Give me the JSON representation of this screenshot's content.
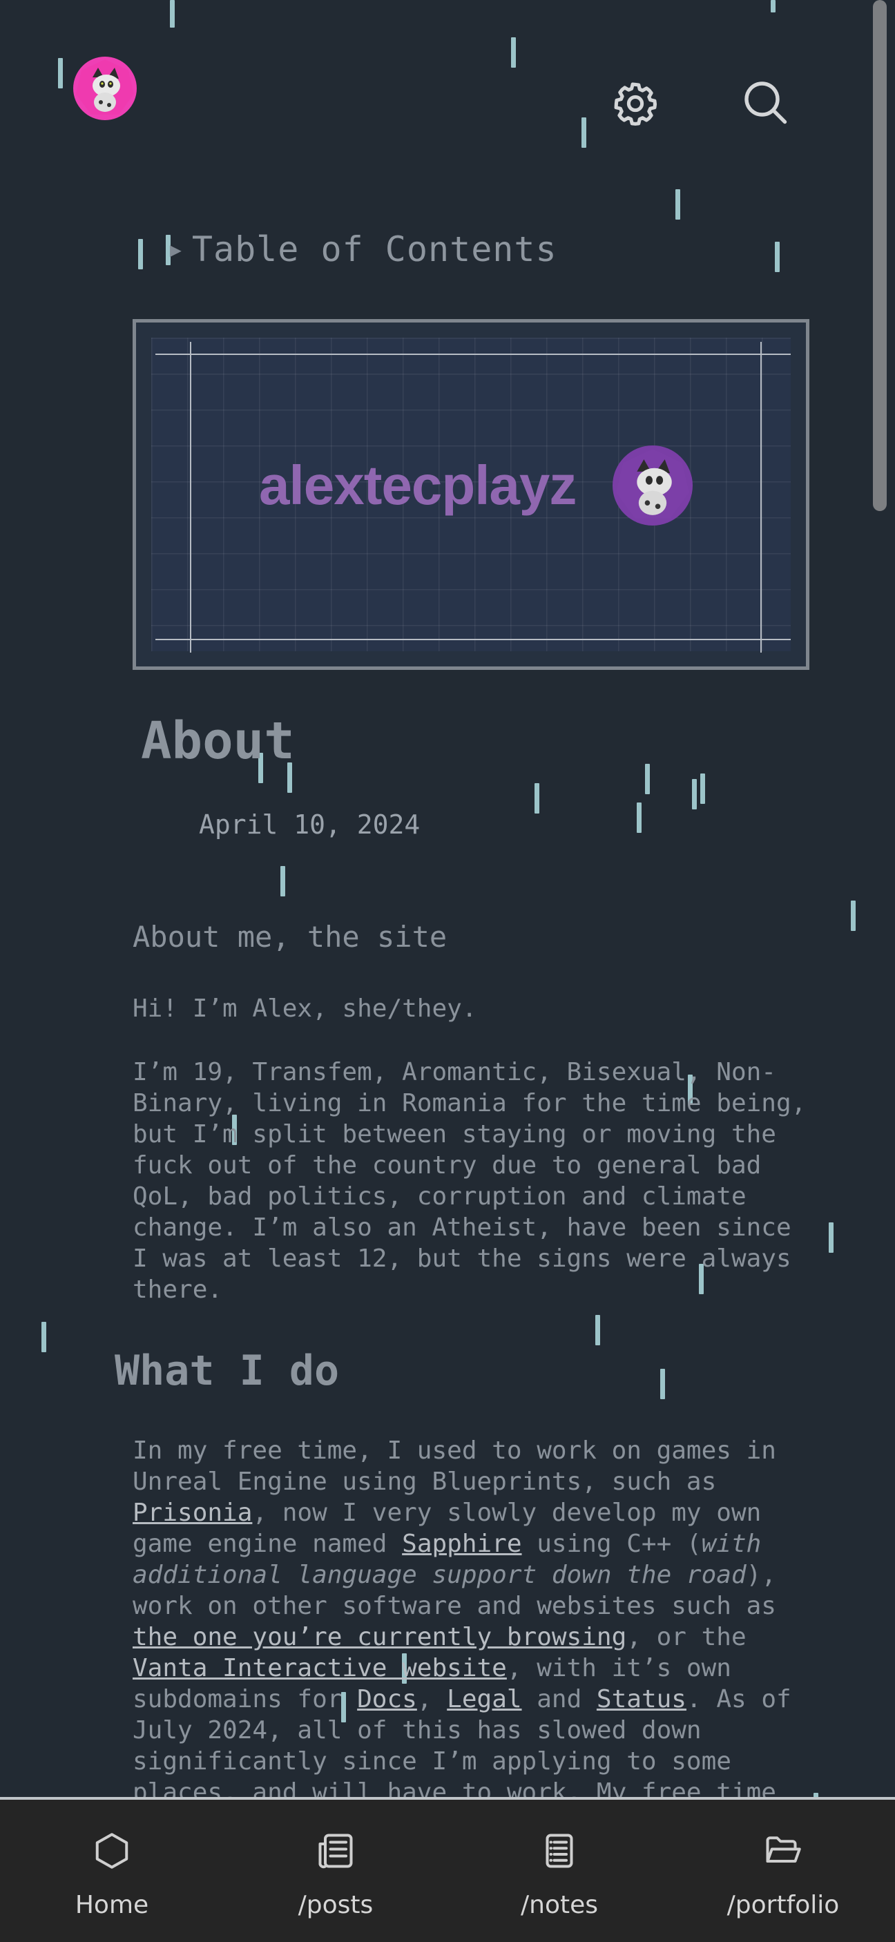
{
  "header": {
    "avatar_icon": "cat-avatar-icon",
    "settings_icon": "gear-icon",
    "search_icon": "search-icon"
  },
  "toc": {
    "label": "Table of Contents"
  },
  "banner": {
    "logo_text": "alextecplayz"
  },
  "article": {
    "title": "About",
    "date": "April 10, 2024",
    "subtitle": "About me, the site",
    "intro": "Hi! I’m Alex, she/they.",
    "bio": "I’m 19, Transfem, Aromantic, Bisexual, Non-Binary, living in Romania for the time being, but I’m split between staying or moving the fuck out of the country due to general bad QoL, bad politics, corruption and climate change. I’m also an Atheist, have been since I was at least 12, but the signs were always there.",
    "section2_title": "What I do",
    "p2": {
      "t1": "In my free time, I used to work on games in Unreal Engine using Blueprints, such as ",
      "link1": "Prisonia",
      "t2": ", now I very slowly develop my own game engine named ",
      "link2": "Sapphire",
      "t3": " using C++ (",
      "italic": "with additional language support down the road",
      "t4": "), work on other software and websites such as ",
      "link3": "the one you’re currently browsing",
      "t5": ", or the ",
      "link4": "Vanta Interactive website",
      "t6": ", with it’s own subdomains for ",
      "link5": "Docs",
      "t7": ", ",
      "link6": "Legal",
      "t8": " and ",
      "link7": "Status",
      "t9": ". As of July 2024, all of this has slowed down significantly since I’m applying to some places, and will have to work. My free time"
    }
  },
  "bottom_nav": [
    {
      "label": "Home",
      "icon": "hexagon-icon"
    },
    {
      "label": "/posts",
      "icon": "newspaper-icon"
    },
    {
      "label": "/notes",
      "icon": "notes-icon"
    },
    {
      "label": "/portfolio",
      "icon": "folder-open-icon"
    }
  ]
}
